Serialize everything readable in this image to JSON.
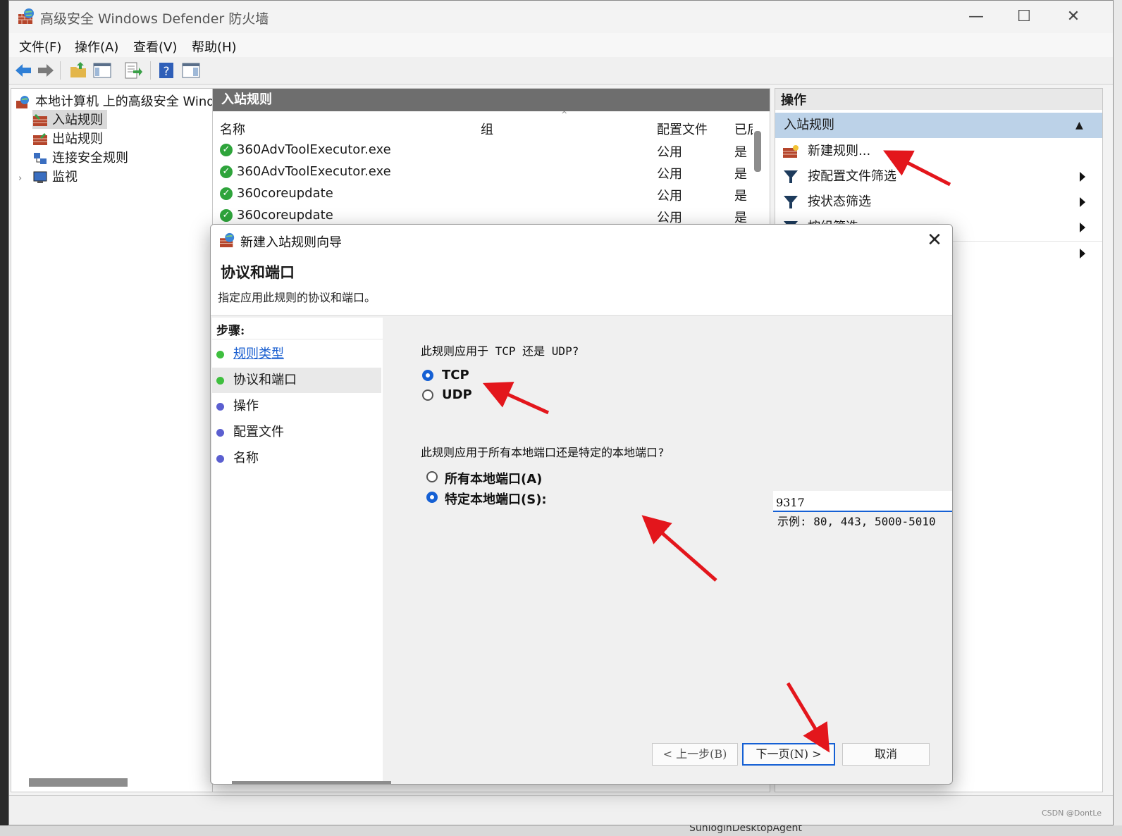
{
  "window": {
    "title": "高级安全 Windows Defender 防火墙",
    "minimize": "—",
    "maximize": "☐",
    "close": "✕"
  },
  "menu": [
    "文件(F)",
    "操作(A)",
    "查看(V)",
    "帮助(H)"
  ],
  "tree": {
    "root": "本地计算机 上的高级安全 Wind",
    "items": [
      "入站规则",
      "出站规则",
      "连接安全规则",
      "监视"
    ]
  },
  "list": {
    "header": "入站规则",
    "columns": [
      "名称",
      "组",
      "配置文件",
      "已后"
    ],
    "rows": [
      {
        "name": "360AdvToolExecutor.exe",
        "profile": "公用",
        "enabled": "是"
      },
      {
        "name": "360AdvToolExecutor.exe",
        "profile": "公用",
        "enabled": "是"
      },
      {
        "name": "360coreupdate",
        "profile": "公用",
        "enabled": "是"
      },
      {
        "name": "360coreupdate",
        "profile": "公用",
        "enabled": "是"
      }
    ]
  },
  "actions": {
    "header": "操作",
    "section": "入站规则",
    "items": [
      "新建规则...",
      "按配置文件筛选",
      "按状态筛选",
      "按组筛选"
    ]
  },
  "wizard": {
    "title": "新建入站规则向导",
    "close": "✕",
    "heading": "协议和端口",
    "subheading": "指定应用此规则的协议和端口。",
    "steps_label": "步骤:",
    "steps": [
      {
        "label": "规则类型",
        "state": "link"
      },
      {
        "label": "协议和端口",
        "state": "current"
      },
      {
        "label": "操作",
        "state": "pending"
      },
      {
        "label": "配置文件",
        "state": "pending"
      },
      {
        "label": "名称",
        "state": "pending"
      }
    ],
    "protocol_question": "此规则应用于 TCP 还是 UDP?",
    "protocols": [
      "TCP",
      "UDP"
    ],
    "protocol_selected": "TCP",
    "port_question": "此规则应用于所有本地端口还是特定的本地端口?",
    "port_options": [
      "所有本地端口(A)",
      "特定本地端口(S):"
    ],
    "port_selected": "特定本地端口(S):",
    "port_value": "9317",
    "port_example": "示例: 80, 443, 5000-5010",
    "buttons": {
      "back": "< 上一步(B)",
      "next": "下一页(N) >",
      "cancel": "取消"
    }
  },
  "background": {
    "taskbar_item": "SunloginDesktopAgent",
    "watermark": "CSDN @DontLe"
  },
  "colors": {
    "accent": "#1560d4",
    "link": "#1a5fd0",
    "status_green": "#2ea43b",
    "annotation_arrow": "#e3161c",
    "actions_section": "#bcd2e8",
    "list_header": "#6e6e6e"
  }
}
